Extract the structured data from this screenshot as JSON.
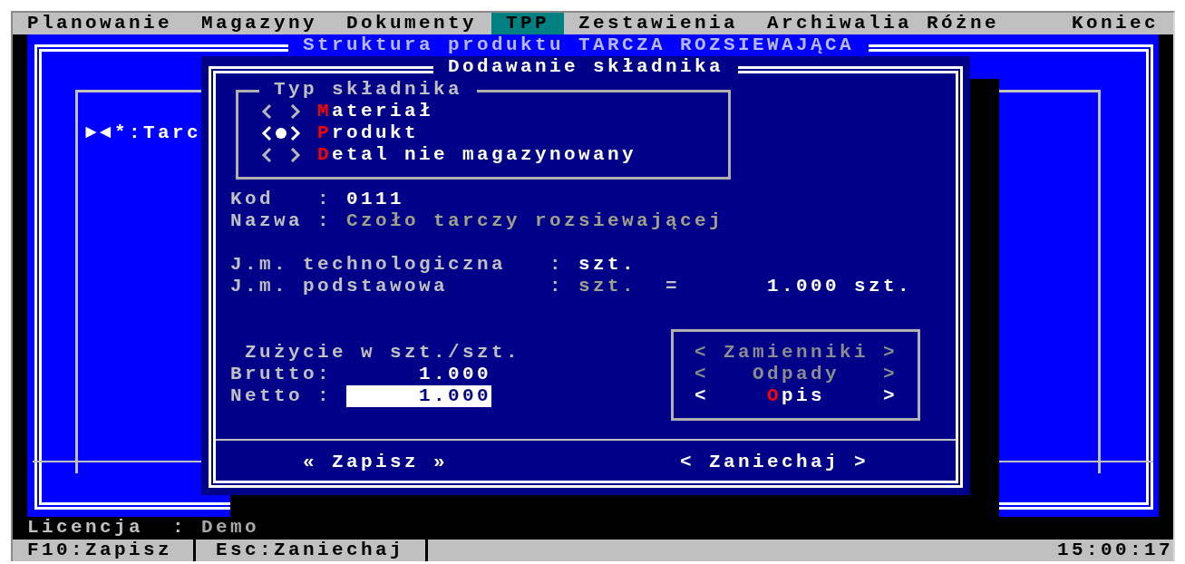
{
  "menu": [
    {
      "label": "Planowanie",
      "selected": false
    },
    {
      "label": "Magazyny",
      "selected": false
    },
    {
      "label": "Dokumenty",
      "selected": false
    },
    {
      "label": "TPP",
      "selected": true
    },
    {
      "label": "Zestawienia",
      "selected": false
    },
    {
      "label": "Archiwalia",
      "selected": false
    },
    {
      "label": "Różne",
      "selected": false
    },
    {
      "label": "Koniec",
      "selected": false
    }
  ],
  "structure_window": {
    "title": "Struktura produktu TARCZA ROZSIEWAJĄCA",
    "tree_row": "►◄*:Tarc"
  },
  "dialog": {
    "title": "Dodawanie składnika",
    "component_type": {
      "title": "Typ składnika",
      "options": [
        {
          "hotkey": "M",
          "label": "ateriał",
          "selected": false
        },
        {
          "hotkey": "P",
          "label": "rodukt",
          "selected": true
        },
        {
          "hotkey": "D",
          "label": "etal nie magazynowany",
          "selected": false
        }
      ]
    },
    "fields": [
      {
        "label": "Kod",
        "sep": ":",
        "value": "0111",
        "disabled": false
      },
      {
        "label": "Nazwa",
        "sep": ":",
        "value": "Czoło tarczy rozsiewającej",
        "disabled": true
      }
    ],
    "units": [
      {
        "label": "J.m. technologiczna",
        "sep": ":",
        "value": "szt.",
        "disabled": false
      },
      {
        "label": "J.m. podstawowa",
        "sep": ":",
        "value": "szt.",
        "disabled": true,
        "equals": "=",
        "amount": "1.000",
        "amount_unit": "szt."
      }
    ],
    "usage": {
      "title": "Zużycie w szt./szt.",
      "rows": [
        {
          "label": "Brutto:",
          "value": "1.000",
          "focused": false
        },
        {
          "label": "Netto :",
          "value": "1.000",
          "focused": true
        }
      ]
    },
    "side_buttons": [
      {
        "left": "<",
        "label": "Zamienniki",
        "right": ">",
        "disabled": true
      },
      {
        "left": "<",
        "label": "Odpady",
        "right": ">",
        "disabled": true
      },
      {
        "left": "<",
        "hotkey": "O",
        "label": "pis",
        "right": ">",
        "disabled": false
      }
    ],
    "buttons": [
      {
        "label": "« Zapisz »"
      },
      {
        "label": "< Zaniechaj >"
      }
    ]
  },
  "license": {
    "label": "Licencja",
    "sep": ":",
    "value": "Demo"
  },
  "status_bar": {
    "keys": [
      "F10:Zapisz",
      "Esc:Zaniechaj"
    ],
    "time": "15:00:17"
  }
}
